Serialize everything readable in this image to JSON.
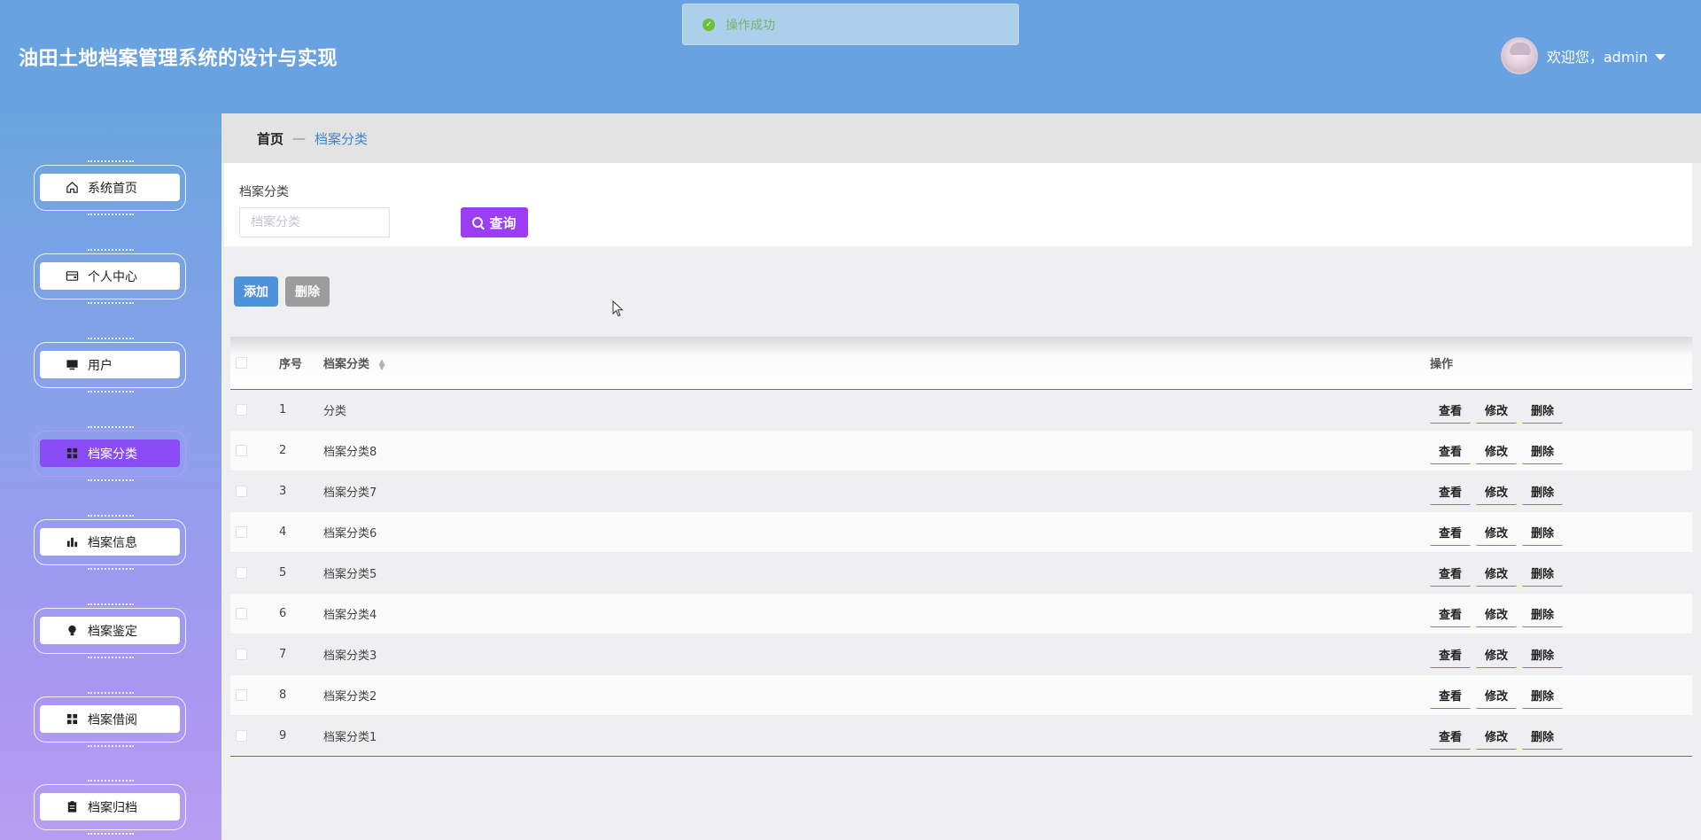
{
  "app": {
    "title": "油田土地档案管理系统的设计与实现"
  },
  "user": {
    "welcome": "欢迎您，admin"
  },
  "toast": {
    "message": "操作成功"
  },
  "sidebar": {
    "items": [
      {
        "label": "系统首页",
        "icon": "home-icon",
        "active": false
      },
      {
        "label": "个人中心",
        "icon": "wallet-icon",
        "active": false
      },
      {
        "label": "用户",
        "icon": "monitor-icon",
        "active": false
      },
      {
        "label": "档案分类",
        "icon": "grid-icon",
        "active": true
      },
      {
        "label": "档案信息",
        "icon": "bar-chart-icon",
        "active": false
      },
      {
        "label": "档案鉴定",
        "icon": "bulb-icon",
        "active": false
      },
      {
        "label": "档案借阅",
        "icon": "grid-icon",
        "active": false
      },
      {
        "label": "档案归档",
        "icon": "clipboard-icon",
        "active": false
      }
    ]
  },
  "breadcrumb": {
    "home": "首页",
    "separator": "—",
    "current": "档案分类"
  },
  "search": {
    "label": "档案分类",
    "placeholder": "档案分类",
    "value": "",
    "button": "查询"
  },
  "actions": {
    "add": "添加",
    "delete": "删除"
  },
  "table": {
    "headers": {
      "index": "序号",
      "name": "档案分类",
      "ops": "操作"
    },
    "op_labels": {
      "view": "查看",
      "edit": "修改",
      "delete": "删除"
    },
    "rows": [
      {
        "index": "1",
        "name": "分类"
      },
      {
        "index": "2",
        "name": "档案分类8"
      },
      {
        "index": "3",
        "name": "档案分类7"
      },
      {
        "index": "4",
        "name": "档案分类6"
      },
      {
        "index": "5",
        "name": "档案分类5"
      },
      {
        "index": "6",
        "name": "档案分类4"
      },
      {
        "index": "7",
        "name": "档案分类3"
      },
      {
        "index": "8",
        "name": "档案分类2"
      },
      {
        "index": "9",
        "name": "档案分类1"
      }
    ]
  },
  "colors": {
    "header": "#68a2e0",
    "accent": "#9b3df5",
    "active_nav": "#8a4cf5",
    "add_button": "#4f92dc"
  }
}
